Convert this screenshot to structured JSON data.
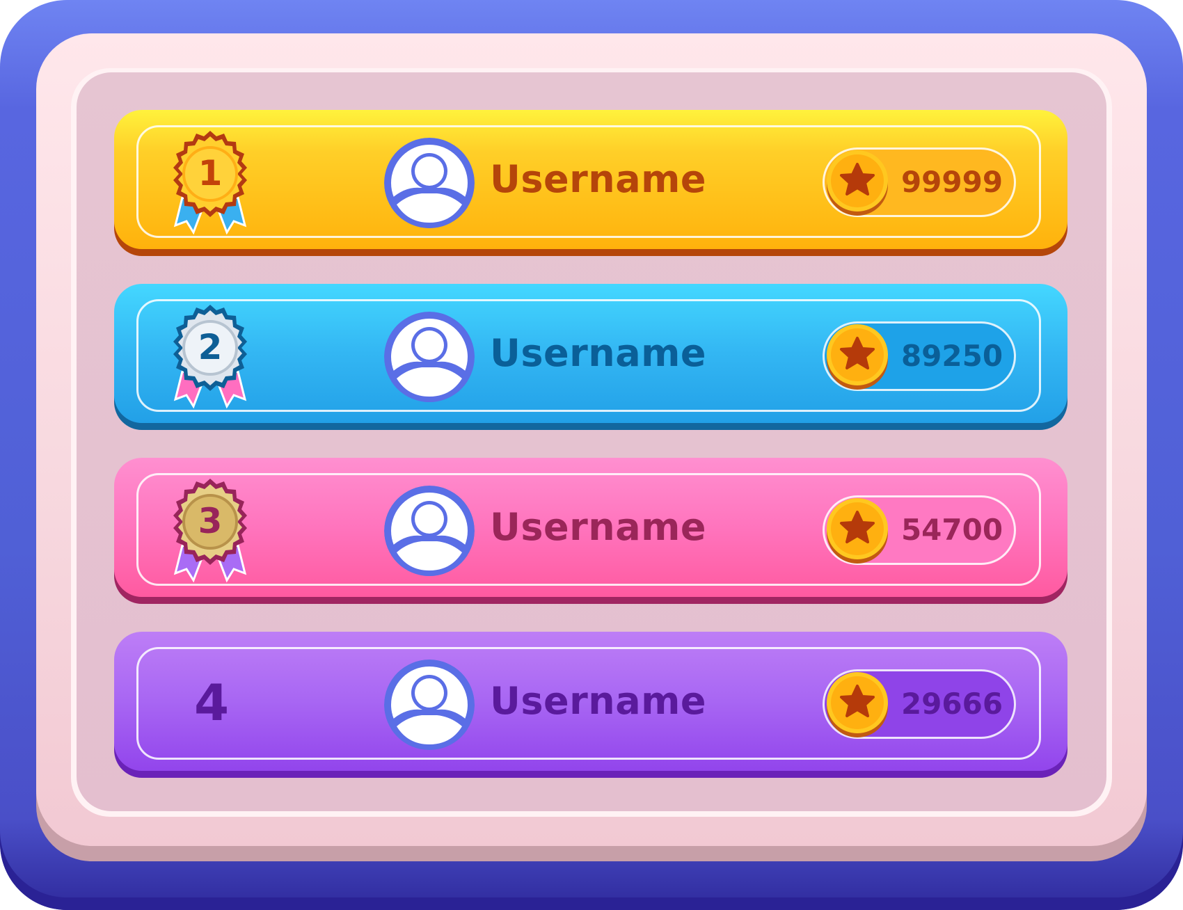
{
  "leaderboard": {
    "entries": [
      {
        "rank": "1",
        "username": "Username",
        "score": "99999",
        "theme": "gold",
        "text_color": "#b5450a",
        "pill_fill": "#ffb820"
      },
      {
        "rank": "2",
        "username": "Username",
        "score": "89250",
        "theme": "blue",
        "text_color": "#0a5f98",
        "pill_fill": "#1ea2e8"
      },
      {
        "rank": "3",
        "username": "Username",
        "score": "54700",
        "theme": "pink",
        "text_color": "#9a2659",
        "pill_fill": "#ff79c2"
      },
      {
        "rank": "4",
        "username": "Username",
        "score": "29666",
        "theme": "purple",
        "text_color": "#5a1a9c",
        "pill_fill": "#8f44e8"
      }
    ]
  },
  "icons": {
    "medal_1": "gold-medal-icon",
    "medal_2": "silver-medal-icon",
    "medal_3": "bronze-medal-icon",
    "avatar": "user-avatar-icon",
    "star": "star-coin-icon"
  },
  "colors": {
    "frame_outer": "#5866e0",
    "panel": "#f7d7de",
    "inner_panel": "#e5c2d0"
  }
}
